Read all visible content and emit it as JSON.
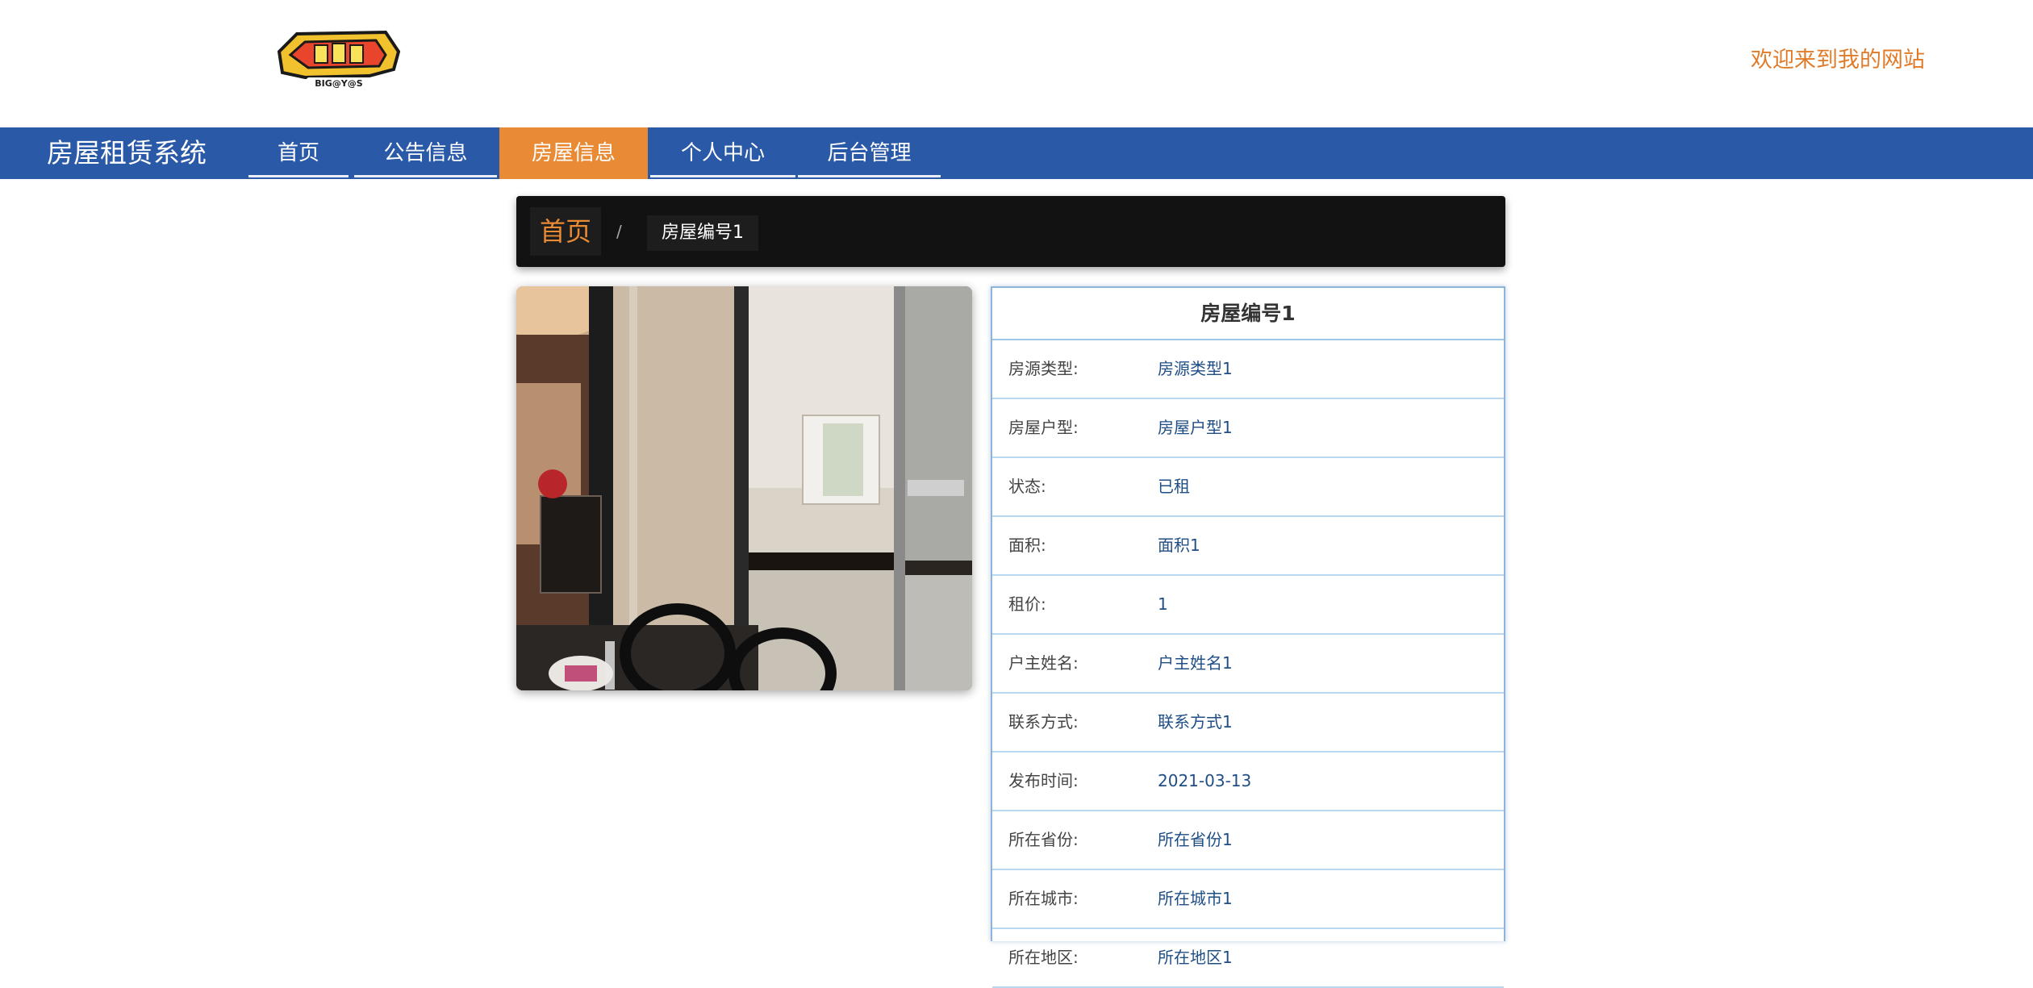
{
  "header": {
    "welcome": "欢迎来到我的网站",
    "logo_text": "BIG@Y@S"
  },
  "nav": {
    "brand": "房屋租赁系统",
    "items": [
      {
        "label": "首页",
        "active": false
      },
      {
        "label": "公告信息",
        "active": false
      },
      {
        "label": "房屋信息",
        "active": true
      },
      {
        "label": "个人中心",
        "active": false
      },
      {
        "label": "后台管理",
        "active": false
      }
    ]
  },
  "breadcrumb": {
    "home": "首页",
    "separator": "/",
    "current": "房屋编号1"
  },
  "detail": {
    "title": "房屋编号1",
    "rows": [
      {
        "label": "房源类型:",
        "value": "房源类型1"
      },
      {
        "label": "房屋户型:",
        "value": "房屋户型1"
      },
      {
        "label": "状态:",
        "value": "已租"
      },
      {
        "label": "面积:",
        "value": "面积1"
      },
      {
        "label": "租价:",
        "value": "1"
      },
      {
        "label": "户主姓名:",
        "value": "户主姓名1"
      },
      {
        "label": "联系方式:",
        "value": "联系方式1"
      },
      {
        "label": "发布时间:",
        "value": "2021-03-13"
      },
      {
        "label": "所在省份:",
        "value": "所在省份1"
      },
      {
        "label": "所在城市:",
        "value": "所在城市1"
      },
      {
        "label": "所在地区:",
        "value": "所在地区1"
      }
    ]
  },
  "colors": {
    "nav": "#2a5aa7",
    "accent": "#e98a35",
    "welcome": "#e07b2a"
  }
}
